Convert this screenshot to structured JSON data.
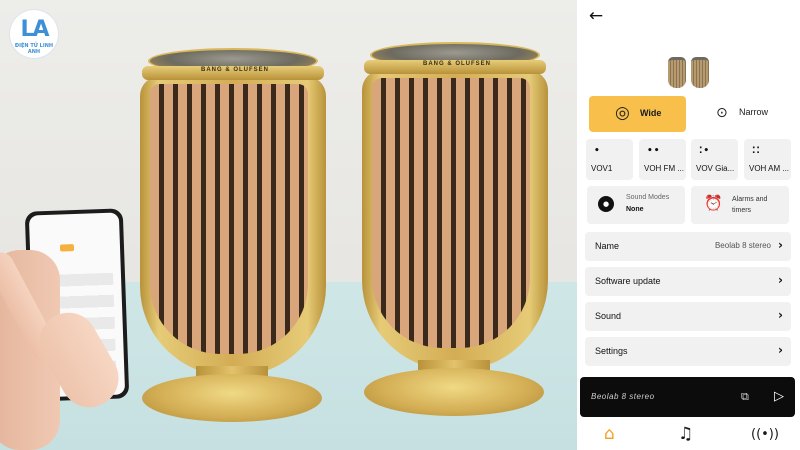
{
  "watermark": {
    "logo_text": "ĐIỆN TỬ LINH ANH"
  },
  "photo": {
    "left_speaker_brand": "BANG & OLUFSEN",
    "right_speaker_brand": "BANG & OLUFSEN"
  },
  "app": {
    "header": {
      "back_icon": "arrow-left-icon"
    },
    "product_image": "speaker-pair-thumbnail",
    "beam_modes": [
      {
        "label": "Wide",
        "icon": "beam-wide-icon",
        "selected": true
      },
      {
        "label": "Narrow",
        "icon": "beam-narrow-icon",
        "selected": false
      }
    ],
    "presets": [
      {
        "label": "VOV1",
        "dots": "•"
      },
      {
        "label": "VOH FM ...",
        "dots": "••"
      },
      {
        "label": "VOV Gia...",
        "dots": "⁚•"
      },
      {
        "label": "VOH AM ...",
        "dots": "⁚⁚"
      }
    ],
    "features": {
      "sound_modes": {
        "title": "Sound Modes",
        "value": "None"
      },
      "alarms": {
        "title": "Alarms and timers"
      }
    },
    "settings_rows": [
      {
        "label": "Name",
        "value": "Beolab 8 stereo"
      },
      {
        "label": "Software update",
        "value": ""
      },
      {
        "label": "Sound",
        "value": ""
      },
      {
        "label": "Settings",
        "value": ""
      }
    ],
    "player": {
      "source": "Beolab 8 stereo"
    },
    "bottom_nav": [
      "home-icon",
      "music-note-icon",
      "radio-broadcast-icon"
    ],
    "colors": {
      "accent": "#F8C04A",
      "nav_active": "#F0A21D",
      "player_bg": "#0C0C0C",
      "card_bg": "#F1F1F1"
    }
  }
}
